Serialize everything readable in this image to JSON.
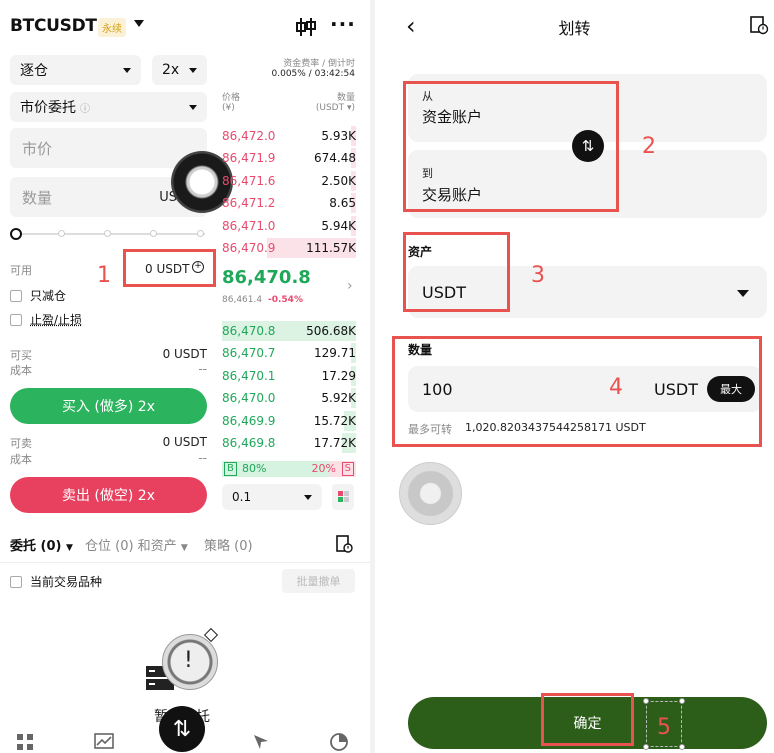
{
  "left": {
    "header": {
      "symbol": "BTCUSDT",
      "badge": "永续",
      "funding_label": "资金费率 / 倒计时",
      "funding_value": "0.005% / 03:42:54"
    },
    "margin_mode": "逐仓",
    "leverage": "2x",
    "order_type": "市价委托",
    "price_placeholder": "市价",
    "qty_placeholder": "数量",
    "qty_unit": "USDT",
    "available_label": "可用",
    "available_value": "0 USDT",
    "reduce_only": "只减仓",
    "tpsl": "止盈/止损",
    "buy_can_label": "可买",
    "buy_can_value": "0 USDT",
    "buy_cost_label": "成本",
    "buy_cost_value": "--",
    "buy_button": "买入 (做多) 2x",
    "sell_can_label": "可卖",
    "sell_can_value": "0 USDT",
    "sell_cost_label": "成本",
    "sell_cost_value": "--",
    "sell_button": "卖出 (做空) 2x",
    "book": {
      "price_head": "价格",
      "price_unit": "(¥)",
      "qty_head": "数量",
      "qty_unit": "(USDT ▾)",
      "asks": [
        {
          "price": "86,472.0",
          "qty": "5.93K"
        },
        {
          "price": "86,471.9",
          "qty": "674.48"
        },
        {
          "price": "86,471.6",
          "qty": "2.50K"
        },
        {
          "price": "86,471.2",
          "qty": "8.65"
        },
        {
          "price": "86,471.0",
          "qty": "5.94K"
        },
        {
          "price": "86,470.9",
          "qty": "111.57K"
        }
      ],
      "last_price": "86,470.8",
      "mark_price": "86,461.4",
      "change": "-0.54%",
      "bids": [
        {
          "price": "86,470.8",
          "qty": "506.68K"
        },
        {
          "price": "86,470.7",
          "qty": "129.71"
        },
        {
          "price": "86,470.1",
          "qty": "17.29"
        },
        {
          "price": "86,470.0",
          "qty": "5.92K"
        },
        {
          "price": "86,469.9",
          "qty": "15.72K"
        },
        {
          "price": "86,469.8",
          "qty": "17.72K"
        }
      ],
      "buy_tag": "B",
      "buy_pct": "80%",
      "sell_pct": "20%",
      "sell_tag": "S",
      "buy_ratio": 0.8,
      "depth_step": "0.1"
    },
    "tabs": {
      "orders": "委托 (0)",
      "positions": "仓位 (0) 和资产",
      "strategy": "策略 (0)"
    },
    "current_pair": "当前交易品种",
    "batch_cancel": "批量撤单",
    "empty_text": "暂无委托"
  },
  "right": {
    "title": "划转",
    "from_label": "从",
    "from_value": "资金账户",
    "to_label": "到",
    "to_value": "交易账户",
    "asset_label": "资产",
    "asset_value": "USDT",
    "amount_label": "数量",
    "amount_value": "100",
    "amount_unit": "USDT",
    "max_button": "最大",
    "max_transfer_label": "最多可转",
    "max_transfer_value": "1,020.8203437544258171 USDT",
    "confirm_button": "确定"
  },
  "annotations": [
    "1",
    "2",
    "3",
    "4",
    "5"
  ],
  "colors": {
    "buy": "#2bb35e",
    "sell": "#e8405f",
    "confirm": "#2c5e1a",
    "annotation": "#e8524f"
  }
}
